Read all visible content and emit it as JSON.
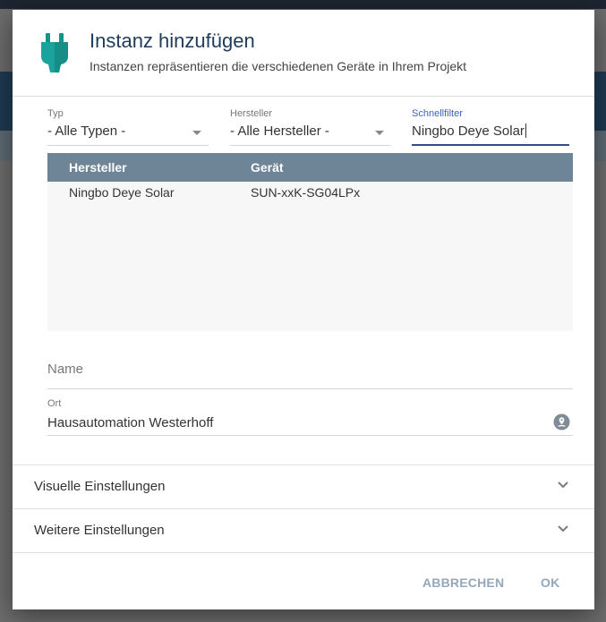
{
  "dialog": {
    "title": "Instanz hinzufügen",
    "subtitle": "Instanzen repräsentieren die verschiedenen Geräte in Ihrem Projekt",
    "icon": "plug-icon",
    "accent_color": "#1aa39c"
  },
  "filters": {
    "typ": {
      "label": "Typ",
      "value": "- Alle Typen -"
    },
    "hersteller": {
      "label": "Hersteller",
      "value": "- Alle Hersteller -"
    },
    "schnellfilter": {
      "label": "Schnellfilter",
      "value": "Ningbo Deye Solar"
    }
  },
  "table": {
    "columns": [
      "Hersteller",
      "Gerät"
    ],
    "rows": [
      [
        "Ningbo Deye Solar",
        "SUN-xxK-SG04LPx"
      ]
    ]
  },
  "name_field": {
    "placeholder": "Name"
  },
  "location_field": {
    "label": "Ort",
    "value": "Hausautomation Westerhoff",
    "icon": "location-pin-icon"
  },
  "sections": [
    {
      "label": "Visuelle Einstellungen",
      "icon": "chevron-down-icon"
    },
    {
      "label": "Weitere Einstellungen",
      "icon": "chevron-down-icon"
    }
  ],
  "footer": {
    "cancel_label": "ABBRECHEN",
    "ok_label": "OK"
  }
}
